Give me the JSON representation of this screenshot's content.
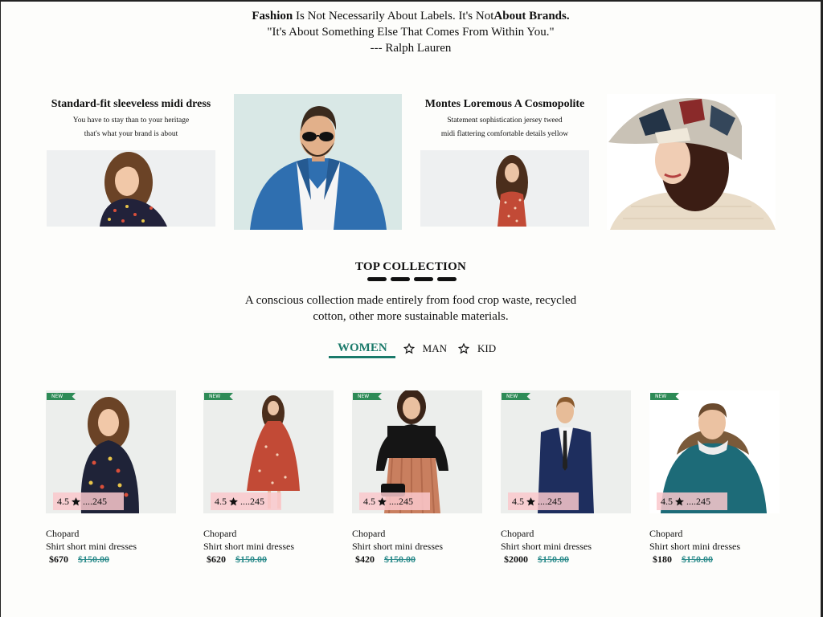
{
  "quote": {
    "line1_bold1": "Fashion",
    "line1_mid": " Is Not Necessarily About Labels. It's Not",
    "line1_bold2": "About Brands.",
    "line2": "\"It's About Something Else That Comes From Within You.\"",
    "line3": "--- Ralph Lauren"
  },
  "features": [
    {
      "title": "Standard-fit sleeveless midi dress",
      "sub1": "You have to stay than to your heritage",
      "sub2": "that's what your brand is about"
    },
    {
      "title": "Montes Loremous A Cosmopolite",
      "sub1": "Statement sophistication jersey tweed",
      "sub2": "midi flattering comfortable details yellow"
    }
  ],
  "collection": {
    "title": "TOP COLLECTION",
    "description": "A conscious collection made entirely from food crop waste, recycled cotton, other more sustainable materials."
  },
  "tabs": {
    "women": "WOMEN",
    "man": "MAN",
    "kid": "KID"
  },
  "products": [
    {
      "badge": "NEW",
      "rating": "4.5",
      "reviews": "....245",
      "brand": "Chopard",
      "name": "Shirt short mini dresses",
      "price": "$670",
      "old_price": "$150.00"
    },
    {
      "badge": "NEW",
      "rating": "4.5",
      "reviews": "....245",
      "brand": "Chopard",
      "name": "Shirt short mini dresses",
      "price": "$620",
      "old_price": "$150.00"
    },
    {
      "badge": "NEW",
      "rating": "4.5",
      "reviews": "....245",
      "brand": "Chopard",
      "name": "Shirt short mini dresses",
      "price": "$420",
      "old_price": "$150.00"
    },
    {
      "badge": "NEW",
      "rating": "4.5",
      "reviews": "....245",
      "brand": "Chopard",
      "name": "Shirt short mini dresses",
      "price": "$2000",
      "old_price": "$150.00"
    },
    {
      "badge": "NEW",
      "rating": "4.5",
      "reviews": "....245",
      "brand": "Chopard",
      "name": "Shirt short mini dresses",
      "price": "$180",
      "old_price": "$150.00"
    }
  ],
  "colors": {
    "accent": "#1a7a6a",
    "badge": "#2e8b57",
    "old_price": "#2a8a8a",
    "rating_bg": "#f9c8cd"
  }
}
